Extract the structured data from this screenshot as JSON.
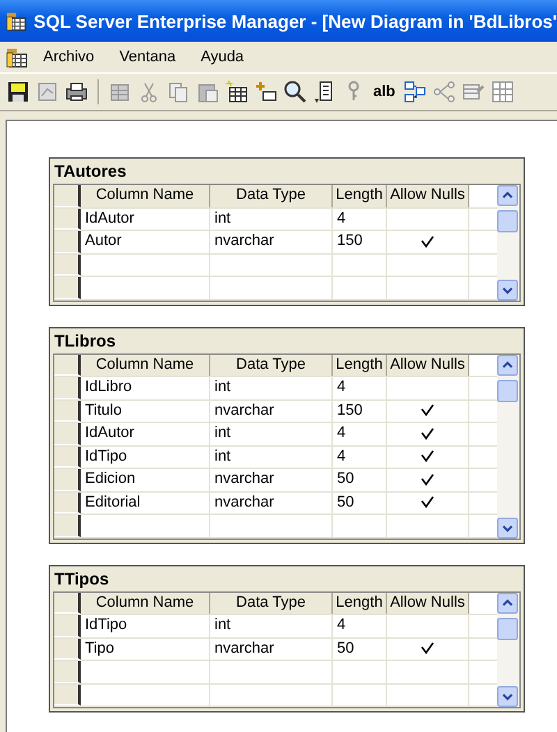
{
  "window": {
    "title": "SQL Server Enterprise Manager - [New Diagram in 'BdLibros'"
  },
  "menu": [
    {
      "label": "Archivo"
    },
    {
      "label": "Ventana"
    },
    {
      "label": "Ayuda"
    }
  ],
  "toolbar": {
    "text_button": "alb"
  },
  "tables": [
    {
      "name": "TAutores",
      "columns": [
        "Column Name",
        "Data Type",
        "Length",
        "Allow Nulls"
      ],
      "rows": [
        {
          "column": "IdAutor",
          "type": "int",
          "length": "4",
          "nullable": false
        },
        {
          "column": "Autor",
          "type": "nvarchar",
          "length": "150",
          "nullable": true
        }
      ]
    },
    {
      "name": "TLibros",
      "columns": [
        "Column Name",
        "Data Type",
        "Length",
        "Allow Nulls"
      ],
      "rows": [
        {
          "column": "IdLibro",
          "type": "int",
          "length": "4",
          "nullable": false
        },
        {
          "column": "Titulo",
          "type": "nvarchar",
          "length": "150",
          "nullable": true
        },
        {
          "column": "IdAutor",
          "type": "int",
          "length": "4",
          "nullable": true
        },
        {
          "column": "IdTipo",
          "type": "int",
          "length": "4",
          "nullable": true
        },
        {
          "column": "Edicion",
          "type": "nvarchar",
          "length": "50",
          "nullable": true
        },
        {
          "column": "Editorial",
          "type": "nvarchar",
          "length": "50",
          "nullable": true
        }
      ]
    },
    {
      "name": "TTipos",
      "columns": [
        "Column Name",
        "Data Type",
        "Length",
        "Allow Nulls"
      ],
      "rows": [
        {
          "column": "IdTipo",
          "type": "int",
          "length": "4",
          "nullable": false
        },
        {
          "column": "Tipo",
          "type": "nvarchar",
          "length": "50",
          "nullable": true
        }
      ]
    }
  ]
}
